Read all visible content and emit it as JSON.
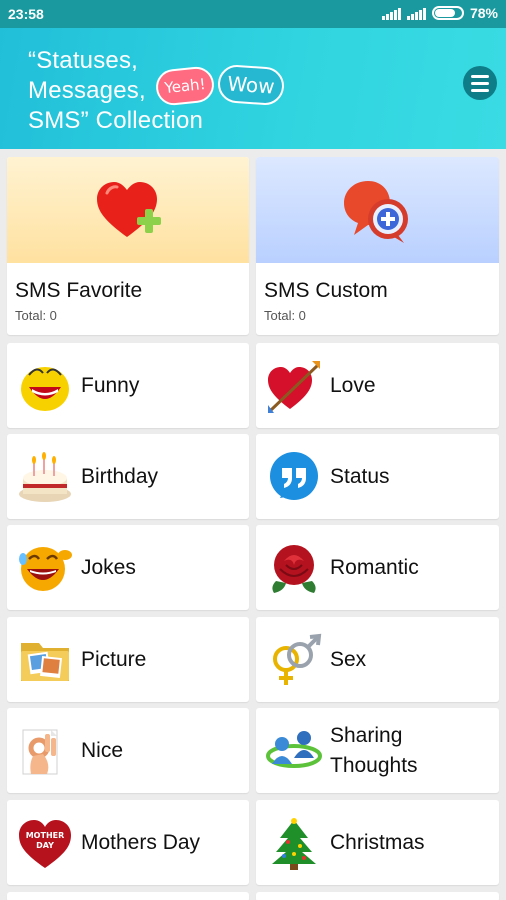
{
  "status_bar": {
    "time": "23:58",
    "battery_percent": "78%",
    "battery_level": 0.78
  },
  "header": {
    "title_lines": [
      "“Statuses,",
      "Messages,",
      "SMS” Collection"
    ],
    "bubble_left": "Yeah!",
    "bubble_right": "Wow",
    "colors": {
      "header_start": "#22bfd9",
      "header_end": "#3adbe3",
      "menu_button": "#0f7d88"
    }
  },
  "featured": [
    {
      "name": "SMS Favorite",
      "total": "Total: 0",
      "icon": "heart-plus-icon"
    },
    {
      "name": "SMS Custom",
      "total": "Total: 0",
      "icon": "chat-bubble-plus-icon"
    }
  ],
  "categories": [
    {
      "label": "Funny",
      "icon": "laughing-smiley-icon"
    },
    {
      "label": "Love",
      "icon": "heart-arrow-icon"
    },
    {
      "label": "Birthday",
      "icon": "birthday-cake-icon"
    },
    {
      "label": "Status",
      "icon": "quote-bubble-icon"
    },
    {
      "label": "Jokes",
      "icon": "laughing-face-icon"
    },
    {
      "label": "Romantic",
      "icon": "red-rose-icon"
    },
    {
      "label": "Picture",
      "icon": "picture-folder-icon"
    },
    {
      "label": "Sex",
      "icon": "gender-symbols-icon"
    },
    {
      "label": "Nice",
      "icon": "ok-hand-icon"
    },
    {
      "label": "Sharing Thoughts",
      "label_lines": [
        "Sharing",
        "Thoughts"
      ],
      "icon": "people-sharing-icon"
    },
    {
      "label": "Mothers Day",
      "icon": "mothers-day-heart-icon",
      "icon_text": [
        "MOTHER",
        "DAY"
      ]
    },
    {
      "label": "Christmas",
      "icon": "christmas-tree-icon"
    }
  ]
}
